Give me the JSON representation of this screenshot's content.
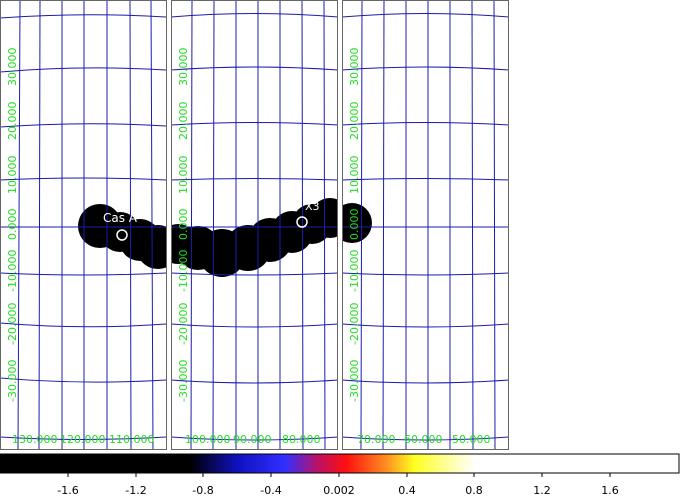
{
  "colors": {
    "background": "#ffffff",
    "grid": "#1c1ca8",
    "panel_border": "#666666",
    "coordinate_labels": "#22dd22",
    "emission": "#000000",
    "source_marker": "#ffffff"
  },
  "panels": [
    {
      "name": "left",
      "lon_labels": [
        "130.000",
        "120.000",
        "110.000"
      ],
      "lat_labels": [
        "30.000",
        "20.000",
        "10.000",
        "0.000",
        "-10.000",
        "-20.000",
        "-30.000"
      ],
      "source": {
        "label": "Cas A"
      }
    },
    {
      "name": "middle",
      "lon_labels": [
        "100.000",
        "90.000",
        "80.000"
      ],
      "lat_labels": [
        "30.000",
        "20.000",
        "10.000",
        "0.000",
        "-10.000",
        "-20.000",
        "-30.000"
      ],
      "source": {
        "label": "X3"
      }
    },
    {
      "name": "right",
      "lon_labels": [
        "70.000",
        "60.000",
        "50.000"
      ],
      "lat_labels": [
        "30.000",
        "20.000",
        "10.000",
        "0.000",
        "-10.000",
        "-20.000",
        "-30.000"
      ]
    }
  ],
  "colorbar": {
    "tick_labels": [
      "-1.6",
      "-1.2",
      "-0.8",
      "-0.4",
      "0.002",
      "0.4",
      "0.8",
      "1.2",
      "1.6"
    ],
    "stops": [
      "#000000",
      "#000000",
      "#0000ff",
      "#ff0000",
      "#ffff00",
      "#ffffff"
    ]
  }
}
